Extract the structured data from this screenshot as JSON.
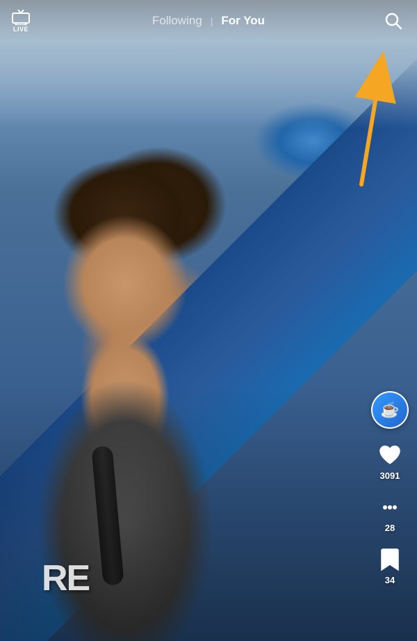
{
  "header": {
    "live_label": "LIVE",
    "following_tab": "Following",
    "foryou_tab": "For You",
    "active_tab": "following"
  },
  "actions": {
    "likes_count": "3091",
    "comments_count": "28",
    "bookmarks_count": "34"
  },
  "shirt_text": "RE",
  "avatar_emoji": "☕",
  "colors": {
    "accent_yellow": "#F5A623",
    "accent_blue": "#2266cc"
  }
}
